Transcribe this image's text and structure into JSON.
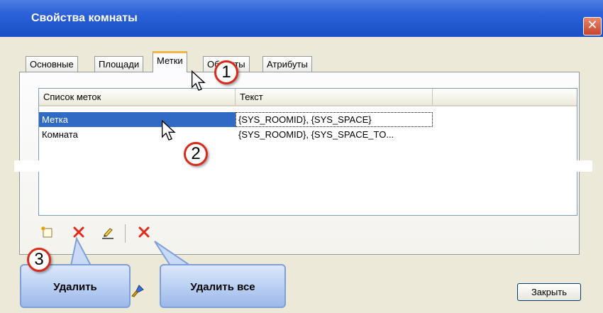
{
  "window": {
    "title": "Свойства комнаты",
    "close_glyph": "✕"
  },
  "tabs": [
    {
      "label": "Основные"
    },
    {
      "label": "Площади"
    },
    {
      "label": "Метки",
      "active": true
    },
    {
      "label": "Объекты"
    },
    {
      "label": "Атрибуты"
    }
  ],
  "list": {
    "columns": [
      "Список меток",
      "Текст"
    ],
    "rows": [
      {
        "name": "Метка",
        "text": "{SYS_ROOMID}, {SYS_SPACE}",
        "selected": true
      },
      {
        "name": "Комната",
        "text": "{SYS_ROOMID}, {SYS_SPACE_TO..."
      }
    ]
  },
  "toolbar": {
    "icons": [
      "new-label-icon",
      "delete-icon",
      "edit-icon",
      "delete-all-icon",
      "brush-icon"
    ],
    "delete_color": "#e02b1b"
  },
  "callouts": {
    "numbers": [
      "1",
      "2",
      "3"
    ],
    "delete_tip": "Удалить",
    "delete_all_tip": "Удалить все"
  },
  "buttons": {
    "close_label": "Закрыть"
  },
  "colors": {
    "titlebar": "#245bd2",
    "selection": "#316ac5",
    "badge_border": "#d92b1b",
    "dialog_bg": "#ece9d8"
  }
}
